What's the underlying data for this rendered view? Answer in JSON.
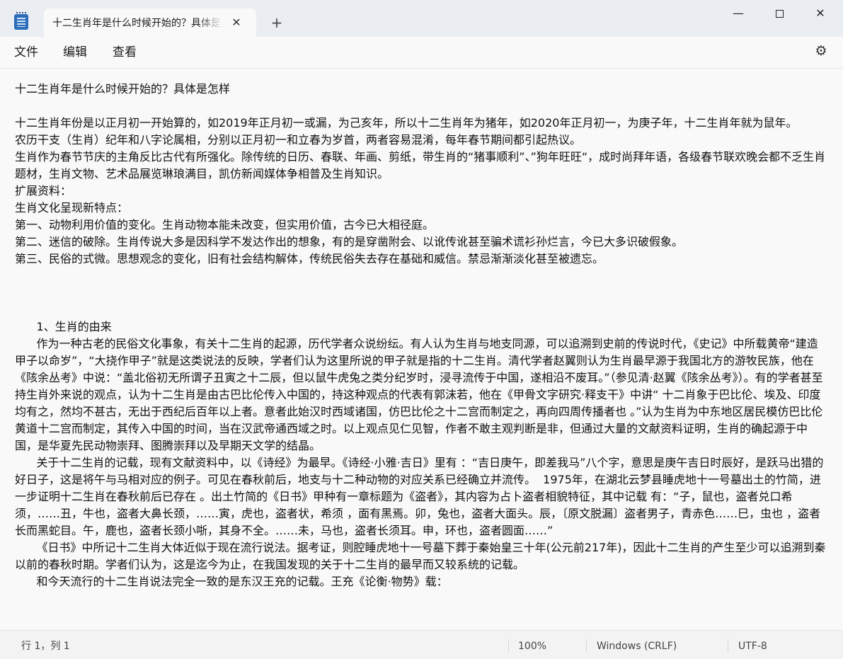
{
  "window": {
    "tab_title": "十二生肖年是什么时候开始的？具体是怎样",
    "tab_close": "✕",
    "new_tab": "+",
    "minimize": "—",
    "close": "✕",
    "icon": "notepad-icon"
  },
  "menu": {
    "file": "文件",
    "edit": "编辑",
    "view": "查看",
    "settings_icon": "gear-icon"
  },
  "document": {
    "title_line": "十二生肖年是什么时候开始的？具体是怎样",
    "section1": [
      "十二生肖年份是以正月初一开始算的，如2019年正月初一或漏，为己亥年，所以十二生肖年为猪年，如2020年正月初一，为庚子年，十二生肖年就为鼠年。",
      "农历干支（生肖）纪年和八字论属相，分别以正月初一和立春为岁首，两者容易混淆，每年春节期间都引起热议。",
      "生肖作为春节节庆的主角反比古代有所强化。除传统的日历、春联、年画、剪纸，带生肖的“猪事顺利”、”狗年旺旺“，成时尚拜年语，各级春节联欢晚会都不乏生肖题材，生肖文物、艺术品展览琳琅满目，凯仿新闻媒体争相普及生肖知识。",
      "扩展资料：",
      "生肖文化呈现新特点：",
      "第一、动物利用价值的变化。生肖动物本能未改变，但实用价值，古今已大相径庭。",
      "第二、迷信的破除。生肖传说大多是因科学不发达作出的想象，有的是穿凿附会、以讹传讹甚至骗术谎衫孙烂言，今已大多识破假象。",
      "第三、民俗的式微。思想观念的变化，旧有社会结构解体，传统民俗失去存在基础和威信。禁忌渐渐淡化甚至被遗忘。"
    ],
    "section2": [
      "      1、生肖的由来",
      "      作为一种古老的民俗文化事象，有关十二生肖的起源，历代学者众说纷纭。有人认为生肖与地支同源，可以追溯到史前的传说时代，《史记》中所载黄帝“建造甲子以命岁”，“大挠作甲子”就是这类说法的反映，学者们认为这里所说的甲子就是指的十二生肖。清代学者赵翼则认为生肖最早源于我国北方的游牧民族，他在《陔余丛考》中说：“盖北俗初无所谓子丑寅之十二辰，但以鼠牛虎兔之类分纪岁时，浸寻流传于中国，遂相沿不废耳。”（参见清·赵翼《陔余丛考》）。有的学者甚至持生肖外来说的观点，认为十二生肖是由古巴比伦传入中国的，持这种观点的代表有郭沫若，他在《甲骨文字研究·释支干》中讲“ 十二肖象于巴比伦、埃及、印度均有之，然均不甚古，无出于西纪后百年以上者。意者此始汉时西域诸国，仿巴比伦之十二宫而制定之，再向四周传播者也 。”认为生肖为中东地区居民模仿巴比伦黄道十二宫而制定，其传入中国的时间，当在汉武帝通西域之时。以上观点见仁见智，作者不敢主观判断是非，但通过大量的文献资料证明，生肖的确起源于中国，是华夏先民动物崇拜、图腾崇拜以及早期天文学的结晶。",
      "      关于十二生肖的记载，现有文献资料中，以《诗经》为最早。《诗经·小雅·吉日》里有 ：“吉日庚午，即差我马”八个字，意思是庚午吉日时辰好，是跃马出猎的好日子，这是将午与马相对应的例子。可见在春秋前后，地支与十二种动物的对应关系已经确立并流传。  1975年，在湖北云梦县睡虎地十一号墓出土的竹简，进一步证明十二生肖在春秋前后已存在 。出土竹简的《日书》甲种有一章标题为《盗者》，其内容为占卜盗者相貌特征，其中记载 有：“子，鼠也，盗者兑口希须，……丑，牛也，盗者大鼻长颈，……寅，虎也，盗者状，希须 ，面有黑焉。卯，兔也，盗者大面头。辰，〔原文脱漏〕盗者男子，青赤色……巳，虫也 ，盗者长而黑蛇目。午，鹿也，盗者长颈小哳，其身不全。……未，马也，盗者长须耳。申，环也，盗者圆面……”",
      "      《日书》中所记十二生肖大体近似于现在流行说法。据考证，则腔睡虎地十一号墓下葬于秦始皇三十年(公元前217年)，因此十二生肖的产生至少可以追溯到秦以前的春秋时期。学者们认为，这是迄今为止，在我国发现的关于十二生肖的最早而又较系统的记载。",
      "      和今天流行的十二生肖说法完全一致的是东汉王充的记载。王充《论衡·物势》载："
    ]
  },
  "status": {
    "position": "行 1，列 1",
    "zoom": "100%",
    "line_ending": "Windows (CRLF)",
    "encoding": "UTF-8"
  }
}
